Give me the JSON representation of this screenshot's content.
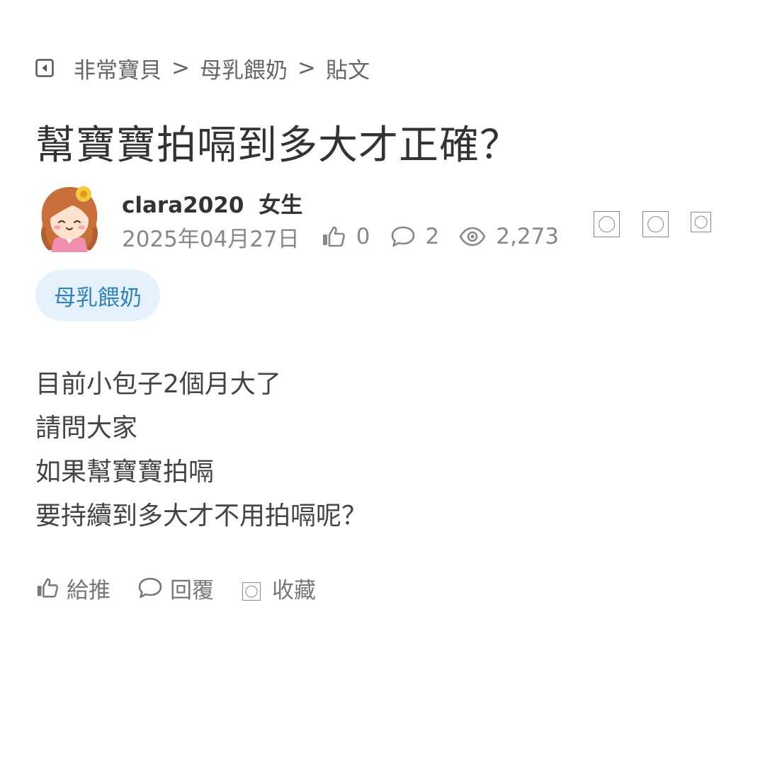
{
  "breadcrumb": {
    "items": [
      "非常寶貝",
      "母乳餵奶",
      "貼文"
    ],
    "separator": ">"
  },
  "post": {
    "title": "幫寶寶拍嗝到多大才正確？",
    "author": "clara2020",
    "gender": "女生",
    "date": "2025年04月27日",
    "likes": "0",
    "comments": "2",
    "views": "2,273",
    "tag": "母乳餵奶",
    "body": [
      "目前小包子2個月大了",
      "請問大家",
      "如果幫寶寶拍嗝",
      "要持續到多大才不用拍嗝呢？"
    ]
  },
  "actions": {
    "push_label": "給推",
    "reply_label": "回覆",
    "favorite_label": "收藏"
  },
  "icons": {
    "back": "back-arrow-icon",
    "like": "thumbs-up-icon",
    "comment": "speech-bubble-icon",
    "views": "eye-icon",
    "share": "placeholder-box-icon"
  },
  "colors": {
    "tag_bg": "#e6f2fb",
    "tag_text": "#2f82bd",
    "text": "#444444",
    "muted": "#888888"
  }
}
